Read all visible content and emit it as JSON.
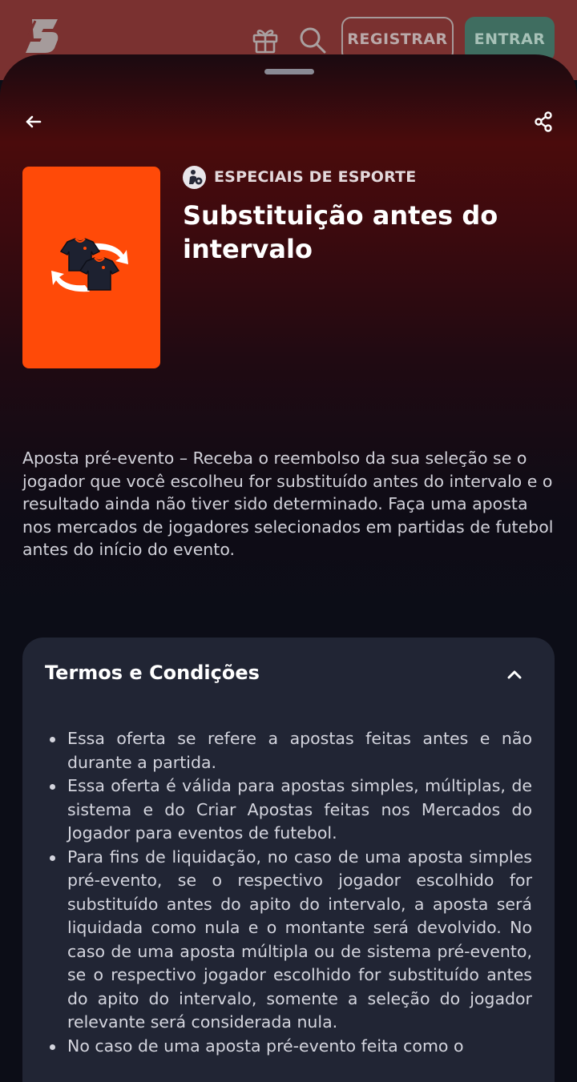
{
  "topbar": {
    "logo_icon": "brand-logo-icon",
    "gift_icon": "gift-icon",
    "search_icon": "search-icon",
    "register_label": "REGISTRAR",
    "enter_label": "ENTRAR",
    "colors": {
      "background": "#7a3130",
      "enter_button": "#3f6d60"
    }
  },
  "sheet": {
    "back_icon": "arrow-left-icon",
    "share_icon": "share-icon",
    "promo_image_icon": "shirts-swap-icon",
    "promo_color": "#ff4a08",
    "category": {
      "icon": "football-player-icon",
      "label": "ESPECIAIS DE ESPORTE"
    },
    "title": "Substituição antes do intervalo",
    "description": "Aposta pré-evento – Receba o reembolso da sua seleção se o jogador que você escolheu for substituído antes do intervalo e o resultado ainda não tiver sido determinado. Faça uma aposta nos mercados de jogadores selecionados em partidas de futebol antes do início do evento.",
    "terms": {
      "title": "Termos e Condições",
      "chevron_icon": "chevron-up-icon",
      "items": [
        "Essa oferta se refere a apostas feitas antes e não durante a partida.",
        "Essa oferta é válida para apostas simples, múltiplas, de sistema e do Criar Apostas feitas nos Mercados do Jogador para eventos de futebol.",
        "Para fins de liquidação, no caso de uma aposta simples pré-evento, se o respectivo jogador escolhido for substituído antes do apito do intervalo, a aposta será liquidada como nula e o montante será devolvido. No caso de uma aposta múltipla ou de sistema pré-evento, se o respectivo jogador escolhido for substituído antes do apito do intervalo, somente a seleção do jogador relevante será considerada nula.",
        "No caso de uma aposta pré-evento feita como o"
      ]
    }
  }
}
